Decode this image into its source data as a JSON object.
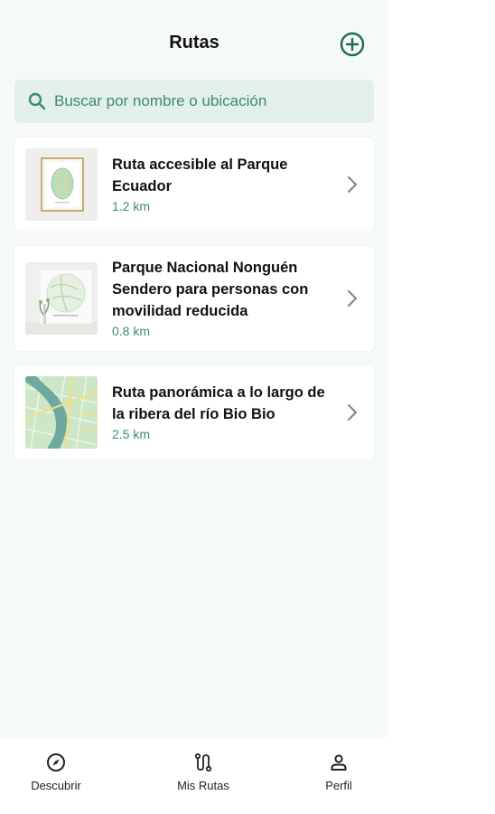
{
  "header": {
    "title": "Rutas"
  },
  "search": {
    "placeholder": "Buscar por nombre o ubicación"
  },
  "routes": [
    {
      "name": "Ruta accesible al Parque Ecuador",
      "distance": "1.2 km"
    },
    {
      "name": "Parque Nacional Nonguén Sendero para personas con movilidad reducida",
      "distance": "0.8 km"
    },
    {
      "name": "Ruta panorámica a lo largo de la ribera del río Bio Bio",
      "distance": "2.5 km"
    }
  ],
  "tabs": [
    {
      "label": "Descubrir",
      "icon": "compass-icon"
    },
    {
      "label": "Mis Rutas",
      "icon": "route-icon"
    },
    {
      "label": "Perfil",
      "icon": "person-icon"
    }
  ],
  "colors": {
    "accent": "#1f6b4f",
    "background": "#f5f9f7",
    "search_bg": "#e3f0ea",
    "distance": "#3e8a70"
  }
}
